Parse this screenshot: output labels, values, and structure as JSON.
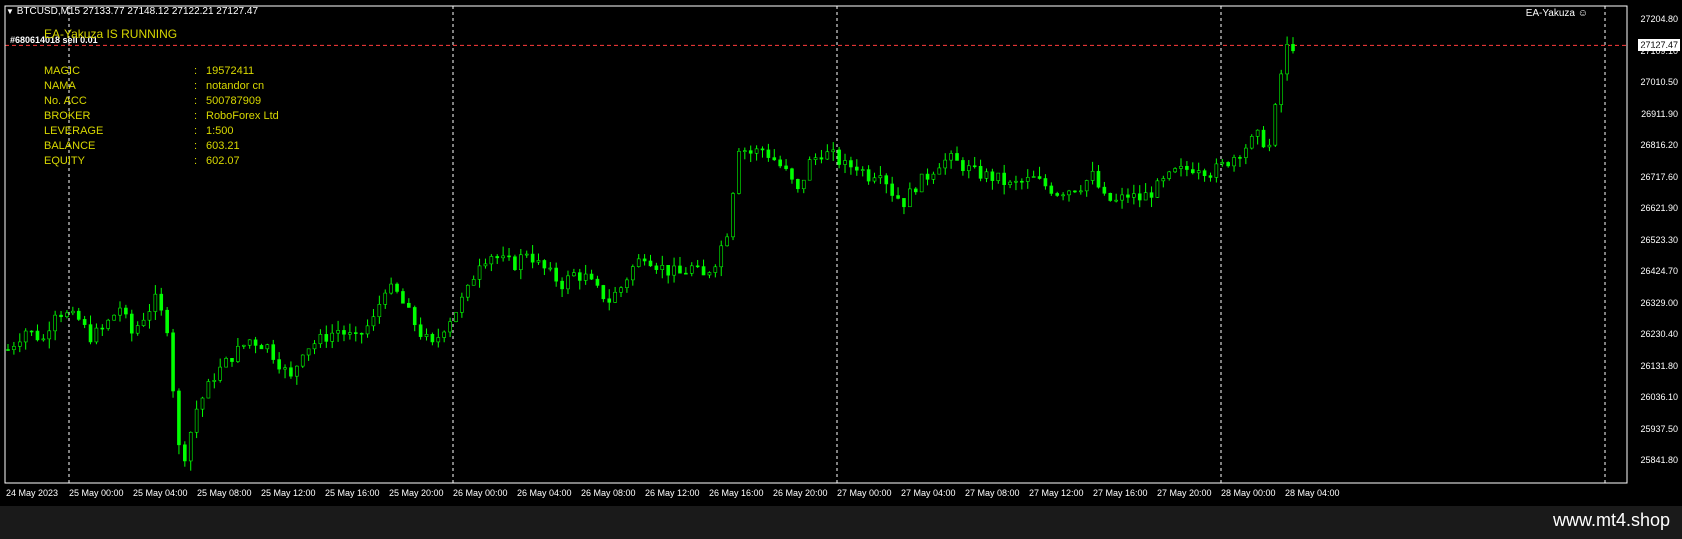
{
  "header": {
    "symbol": "BTCUSD,M15",
    "ohlc": "27133.77 27148.12 27122.21 27127.47"
  },
  "ea": {
    "name": "EA-Yakuza",
    "running_text": "EA-Yakuza IS RUNNING",
    "ticket": "#680614018 sell 0.01"
  },
  "account_info": [
    {
      "label": "MAGIC",
      "value": "19572411"
    },
    {
      "label": "NAMA",
      "value": "notandor cn"
    },
    {
      "label": "No. ACC",
      "value": "500787909"
    },
    {
      "label": "BROKER",
      "value": "RoboForex Ltd"
    },
    {
      "label": "LEVERAGE",
      "value": "1:500"
    },
    {
      "label": "BALANCE",
      "value": "603.21"
    },
    {
      "label": "EQUITY",
      "value": "602.07"
    }
  ],
  "bid_price": "27127.47",
  "watermark": "www.mt4.shop",
  "colors": {
    "background": "#000000",
    "candle": "#00ff00",
    "info_text": "#d8d800",
    "bid_line": "#ff3b3b",
    "grid": "#ffffff"
  },
  "chart_data": {
    "type": "candlestick",
    "y_tick_labels": [
      "27204.80",
      "27109.10",
      "27010.50",
      "26911.90",
      "26816.20",
      "26717.60",
      "26621.90",
      "26523.30",
      "26424.70",
      "26329.00",
      "26230.40",
      "26131.80",
      "26036.10",
      "25937.50",
      "25841.80"
    ],
    "x_tick_labels": [
      "24 May 2023",
      "25 May 00:00",
      "25 May 04:00",
      "25 May 08:00",
      "25 May 12:00",
      "25 May 16:00",
      "25 May 20:00",
      "26 May 00:00",
      "26 May 04:00",
      "26 May 08:00",
      "26 May 12:00",
      "26 May 16:00",
      "26 May 20:00",
      "27 May 00:00",
      "27 May 04:00",
      "27 May 08:00",
      "27 May 12:00",
      "27 May 16:00",
      "27 May 20:00",
      "28 May 00:00",
      "28 May 04:00"
    ],
    "ylim": [
      25841.8,
      27204.8
    ],
    "grid": "vertical dashed lines at day separators",
    "price_path": [
      [
        0,
        26200
      ],
      [
        3,
        26260
      ],
      [
        6,
        26230
      ],
      [
        8,
        26320
      ],
      [
        12,
        26290
      ],
      [
        14,
        26240
      ],
      [
        16,
        26260
      ],
      [
        19,
        26330
      ],
      [
        21,
        26250
      ],
      [
        23,
        26300
      ],
      [
        25,
        26350
      ],
      [
        27,
        26270
      ],
      [
        29,
        25900
      ],
      [
        30,
        25880
      ],
      [
        32,
        26020
      ],
      [
        35,
        26120
      ],
      [
        38,
        26180
      ],
      [
        41,
        26230
      ],
      [
        44,
        26210
      ],
      [
        46,
        26160
      ],
      [
        48,
        26110
      ],
      [
        50,
        26200
      ],
      [
        53,
        26230
      ],
      [
        56,
        26260
      ],
      [
        59,
        26230
      ],
      [
        62,
        26290
      ],
      [
        64,
        26390
      ],
      [
        66,
        26370
      ],
      [
        68,
        26310
      ],
      [
        70,
        26250
      ],
      [
        72,
        26210
      ],
      [
        74,
        26270
      ],
      [
        76,
        26320
      ],
      [
        78,
        26380
      ],
      [
        80,
        26470
      ],
      [
        82,
        26490
      ],
      [
        84,
        26470
      ],
      [
        86,
        26460
      ],
      [
        88,
        26500
      ],
      [
        90,
        26460
      ],
      [
        92,
        26430
      ],
      [
        94,
        26400
      ],
      [
        96,
        26430
      ],
      [
        98,
        26420
      ],
      [
        100,
        26380
      ],
      [
        102,
        26350
      ],
      [
        104,
        26390
      ],
      [
        106,
        26450
      ],
      [
        108,
        26490
      ],
      [
        110,
        26460
      ],
      [
        112,
        26440
      ],
      [
        114,
        26430
      ],
      [
        116,
        26450
      ],
      [
        118,
        26420
      ],
      [
        120,
        26470
      ],
      [
        122,
        26560
      ],
      [
        124,
        26820
      ],
      [
        126,
        26800
      ],
      [
        128,
        26810
      ],
      [
        130,
        26780
      ],
      [
        132,
        26740
      ],
      [
        134,
        26680
      ],
      [
        136,
        26770
      ],
      [
        138,
        26800
      ],
      [
        140,
        26790
      ],
      [
        142,
        26760
      ],
      [
        144,
        26760
      ],
      [
        146,
        26730
      ],
      [
        148,
        26750
      ],
      [
        150,
        26680
      ],
      [
        152,
        26650
      ],
      [
        154,
        26700
      ],
      [
        156,
        26730
      ],
      [
        158,
        26770
      ],
      [
        160,
        26780
      ],
      [
        162,
        26760
      ],
      [
        164,
        26740
      ],
      [
        166,
        26730
      ],
      [
        168,
        26720
      ],
      [
        170,
        26700
      ],
      [
        172,
        26710
      ],
      [
        174,
        26720
      ],
      [
        176,
        26700
      ],
      [
        178,
        26680
      ],
      [
        180,
        26690
      ],
      [
        182,
        26700
      ],
      [
        184,
        26730
      ],
      [
        186,
        26660
      ],
      [
        188,
        26650
      ],
      [
        190,
        26670
      ],
      [
        192,
        26660
      ],
      [
        194,
        26680
      ],
      [
        196,
        26710
      ],
      [
        198,
        26740
      ],
      [
        200,
        26750
      ],
      [
        202,
        26760
      ],
      [
        204,
        26740
      ],
      [
        206,
        26760
      ],
      [
        208,
        26790
      ],
      [
        210,
        26820
      ],
      [
        212,
        26850
      ],
      [
        214,
        26820
      ],
      [
        216,
        27040
      ],
      [
        217,
        27120
      ],
      [
        218,
        27127
      ]
    ]
  }
}
